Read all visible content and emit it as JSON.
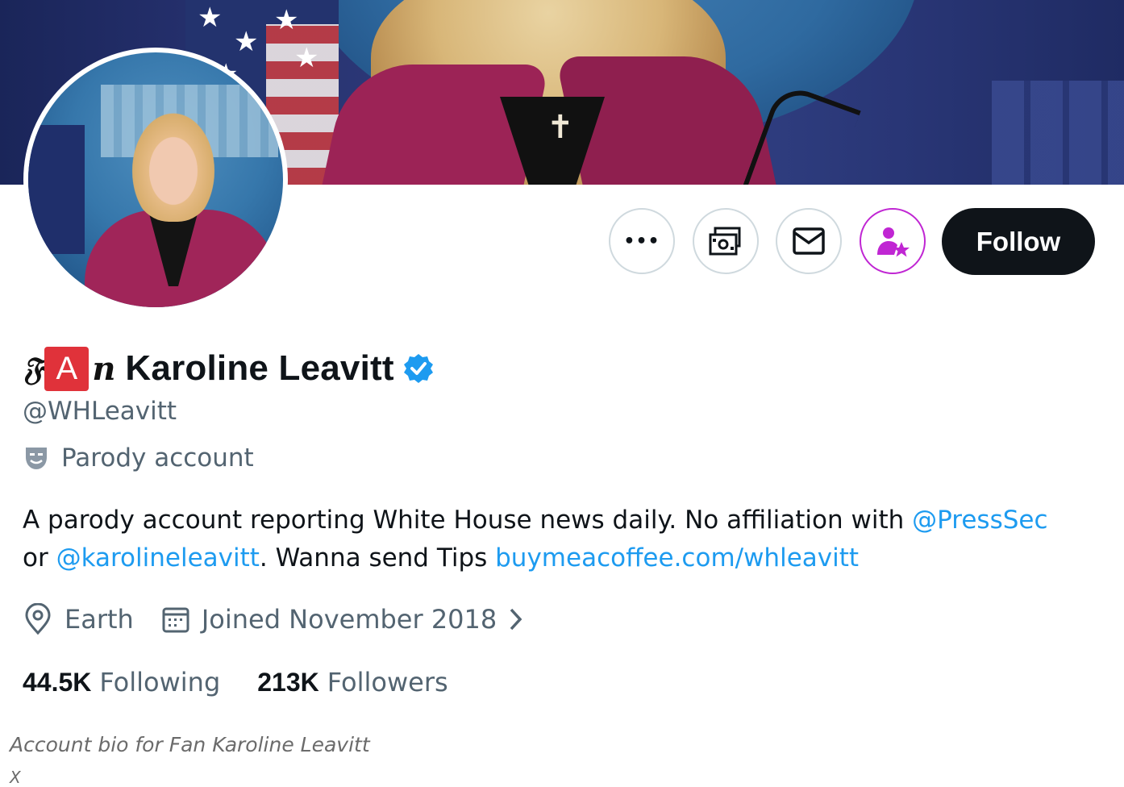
{
  "profile": {
    "name_prefix": {
      "f_glyph": "𝔉",
      "a_letter": "A",
      "n_letter": "n"
    },
    "display_name": "Karoline Leavitt",
    "handle": "@WHLeavitt",
    "parody_label": "Parody account",
    "bio": {
      "part1": "A parody account reporting White House news daily. No affiliation with ",
      "mention1": "@PressSec",
      "part2": "or ",
      "mention2": "@karolineleavitt",
      "part3": ". Wanna send Tips ",
      "link": "buymeacoffee.com/whleavitt"
    },
    "location": "Earth",
    "joined": "Joined November 2018",
    "following_count": "44.5K",
    "following_label": "Following",
    "followers_count": "213K",
    "followers_label": "Followers"
  },
  "actions": {
    "more_glyph": "•••",
    "follow_label": "Follow"
  },
  "icons": {
    "more": "more-icon",
    "money": "money-icon",
    "message": "envelope-icon",
    "subscribe": "subscribe-icon",
    "verified": "verified-badge-icon",
    "parody": "theater-mask-icon",
    "location": "location-pin-icon",
    "calendar": "calendar-icon",
    "chevron": "chevron-right-icon"
  },
  "colors": {
    "link": "#1d9bf0",
    "subscribe_accent": "#c026d3",
    "verified": "#1d9bf0",
    "follow_bg": "#0f1419",
    "prefix_red": "#e0323a"
  },
  "caption": {
    "text": "Account bio for Fan Karoline Leavitt",
    "source": "X"
  }
}
